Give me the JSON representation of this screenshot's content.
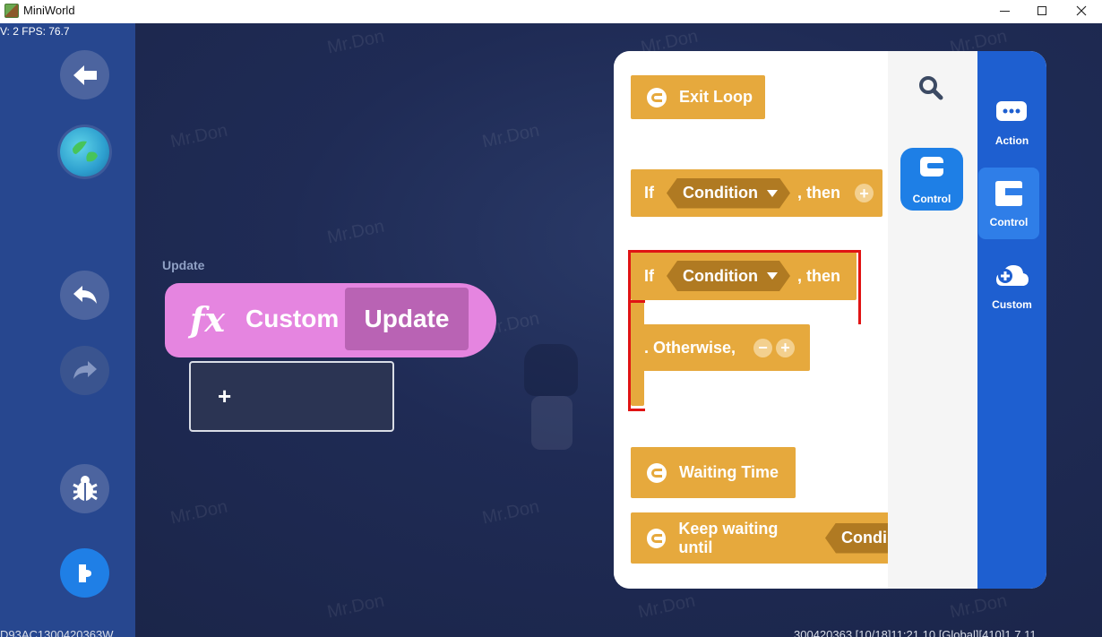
{
  "window": {
    "title": "MiniWorld",
    "minimize": "—",
    "maximize": "☐",
    "close": "✕"
  },
  "hud": {
    "fps_text": "V: 2 FPS: 76.7",
    "bottom_left_text": "D93AC1300420363W",
    "bottom_right_text": "300420363    [10/18]11:21.10  [Global][410]1.7.11"
  },
  "watermark": "Mr.Don",
  "rail": {
    "buttons": [
      "back-arrow-icon",
      "globe-icon",
      "undo-icon",
      "redo-icon",
      "bug-icon",
      "puzzle-icon"
    ]
  },
  "canvas": {
    "caption": "Update",
    "fx_symbol": "fx",
    "fx_custom": "Custom",
    "fx_update": "Update",
    "slot_plus": "+"
  },
  "palette": {
    "blocks": {
      "exit_loop": "Exit Loop",
      "if1_if": "If",
      "if1_cond": "Condition",
      "if1_then": ", then",
      "if2_if": "If",
      "if2_cond": "Condition",
      "if2_then": ", then",
      "otherwise": ". Otherwise,",
      "waiting_time": "Waiting Time",
      "keep_waiting": "Keep waiting until",
      "keep_cond": "Condi",
      "plus": "+",
      "minus": "−"
    },
    "selected_tile": "Control",
    "categories": [
      "Action",
      "Control",
      "Custom"
    ],
    "active_category": "Control"
  },
  "colors": {
    "block": "#e6a93d",
    "condition": "#b07a22",
    "custom_block": "#e585e0",
    "category_bg": "#1e5fd0",
    "highlight": "#e01414"
  }
}
